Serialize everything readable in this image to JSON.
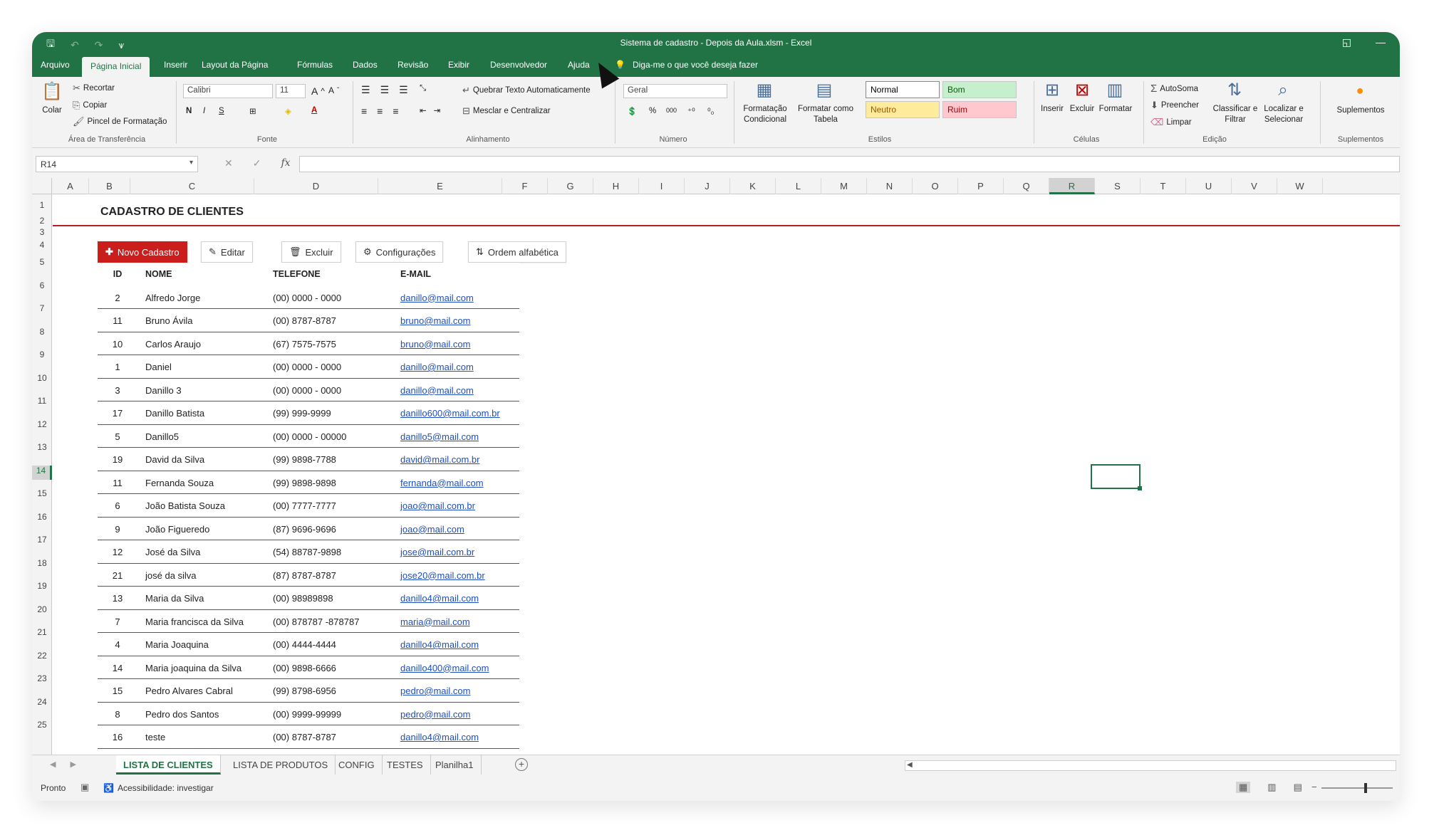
{
  "window": {
    "title": "Sistema de cadastro - Depois da Aula.xlsm  -  Excel",
    "qat": {
      "save": "🖫",
      "undo": "↶",
      "redo": "↷",
      "more": "⩛"
    },
    "controls": {
      "restore": "◱",
      "minimize": "—"
    }
  },
  "ribbon_tabs": [
    "Arquivo",
    "Página Inicial",
    "Inserir",
    "Layout da Página",
    "Fórmulas",
    "Dados",
    "Revisão",
    "Exibir",
    "Desenvolvedor",
    "Ajuda"
  ],
  "tell_me": "Diga-me o que você deseja fazer",
  "ribbon": {
    "clipboard": {
      "paste": "Colar",
      "cut": "Recortar",
      "copy": "Copiar",
      "format_painter": "Pincel de Formatação",
      "label": "Área de Transferência"
    },
    "font": {
      "name": "Calibri",
      "size": "11",
      "bold": "N",
      "italic": "I",
      "underline": "S",
      "label": "Fonte"
    },
    "alignment": {
      "wrap": "Quebrar Texto Automaticamente",
      "merge": "Mesclar e Centralizar",
      "label": "Alinhamento"
    },
    "number": {
      "format": "Geral",
      "percent": "%",
      "thousands": "000",
      "label": "Número"
    },
    "styles": {
      "conditional": "Formatação Condicional",
      "table": "Formatar como Tabela",
      "normal": "Normal",
      "bom": "Bom",
      "neutro": "Neutro",
      "ruim": "Ruim",
      "label": "Estilos"
    },
    "cells": {
      "insert": "Inserir",
      "delete": "Excluir",
      "format": "Formatar",
      "label": "Células"
    },
    "editing": {
      "autosum": "AutoSoma",
      "fill": "Preencher",
      "clear": "Limpar",
      "sort": "Classificar e Filtrar",
      "find": "Localizar e Selecionar",
      "label": "Edição"
    },
    "addins": {
      "addins": "Suplementos",
      "label": "Suplementos"
    }
  },
  "formula_bar": {
    "name_box": "R14",
    "cancel": "✕",
    "enter": "✓",
    "fx": "fx",
    "value": ""
  },
  "columns": [
    "A",
    "B",
    "C",
    "D",
    "E",
    "F",
    "G",
    "H",
    "I",
    "J",
    "K",
    "L",
    "M",
    "N",
    "O",
    "P",
    "Q",
    "R",
    "S",
    "T",
    "U",
    "V",
    "W"
  ],
  "rows": [
    "1",
    "2",
    "3",
    "4",
    "5",
    "6",
    "7",
    "8",
    "9",
    "10",
    "11",
    "12",
    "13",
    "14",
    "15",
    "16",
    "17",
    "18",
    "19",
    "20",
    "21",
    "22",
    "23",
    "24",
    "25"
  ],
  "sheet": {
    "title": "CADASTRO DE CLIENTES",
    "buttons": {
      "new": "Novo Cadastro",
      "edit": "Editar",
      "delete": "Excluir",
      "settings": "Configurações",
      "sort": "Ordem alfabética"
    },
    "headers": {
      "id": "ID",
      "nome": "NOME",
      "telefone": "TELEFONE",
      "email": "E-MAIL"
    },
    "clientes": [
      {
        "id": "2",
        "nome": "Alfredo Jorge",
        "telefone": "(00) 0000 - 0000",
        "email": "danillo@mail.com"
      },
      {
        "id": "11",
        "nome": "Bruno Ávila",
        "telefone": "(00) 8787-8787",
        "email": "bruno@mail.com"
      },
      {
        "id": "10",
        "nome": "Carlos Araujo",
        "telefone": "(67) 7575-7575",
        "email": "bruno@mail.com"
      },
      {
        "id": "1",
        "nome": "Daniel",
        "telefone": "(00) 0000 - 0000",
        "email": "danillo@mail.com"
      },
      {
        "id": "3",
        "nome": "Danillo 3",
        "telefone": "(00) 0000 - 0000",
        "email": "danillo@mail.com"
      },
      {
        "id": "17",
        "nome": "Danillo Batista",
        "telefone": "(99) 999-9999",
        "email": "danillo600@mail.com.br"
      },
      {
        "id": "5",
        "nome": "Danillo5",
        "telefone": "(00) 0000 - 00000",
        "email": "danillo5@mail.com"
      },
      {
        "id": "19",
        "nome": "David da Silva",
        "telefone": "(99) 9898-7788",
        "email": "david@mail.com.br"
      },
      {
        "id": "11",
        "nome": "Fernanda Souza",
        "telefone": "(99) 9898-9898",
        "email": "fernanda@mail.com"
      },
      {
        "id": "6",
        "nome": "João Batista Souza",
        "telefone": "(00) 7777-7777",
        "email": "joao@mail.com.br"
      },
      {
        "id": "9",
        "nome": "João Figueredo",
        "telefone": "(87) 9696-9696",
        "email": "joao@mail.com"
      },
      {
        "id": "12",
        "nome": "José da Silva",
        "telefone": "(54) 88787-9898",
        "email": "jose@mail.com.br"
      },
      {
        "id": "21",
        "nome": "josé da silva",
        "telefone": "(87) 8787-8787",
        "email": "jose20@mail.com.br"
      },
      {
        "id": "13",
        "nome": "Maria da Silva",
        "telefone": "(00) 98989898",
        "email": "danillo4@mail.com"
      },
      {
        "id": "7",
        "nome": "Maria francisca da Silva",
        "telefone": "(00) 878787 -878787",
        "email": "maria@mail.com"
      },
      {
        "id": "4",
        "nome": "Maria Joaquina",
        "telefone": "(00) 4444-4444",
        "email": "danillo4@mail.com"
      },
      {
        "id": "14",
        "nome": "Maria joaquina da Silva",
        "telefone": "(00) 9898-6666",
        "email": "danillo400@mail.com"
      },
      {
        "id": "15",
        "nome": "Pedro Alvares Cabral",
        "telefone": "(99) 8798-6956",
        "email": "pedro@mail.com"
      },
      {
        "id": "8",
        "nome": "Pedro dos Santos",
        "telefone": "(00) 9999-99999",
        "email": "pedro@mail.com"
      },
      {
        "id": "16",
        "nome": "teste",
        "telefone": "(00) 8787-8787",
        "email": "danillo4@mail.com"
      }
    ]
  },
  "sheet_tabs": [
    "LISTA DE CLIENTES",
    "LISTA DE PRODUTOS",
    "CONFIG",
    "TESTES",
    "Planilha1"
  ],
  "status": {
    "ready": "Pronto",
    "accessibility": "Acessibilidade: investigar"
  },
  "colors": {
    "excel_green": "#217346",
    "brand_red": "#cc1d1d",
    "link_blue": "#1f4fbd"
  }
}
